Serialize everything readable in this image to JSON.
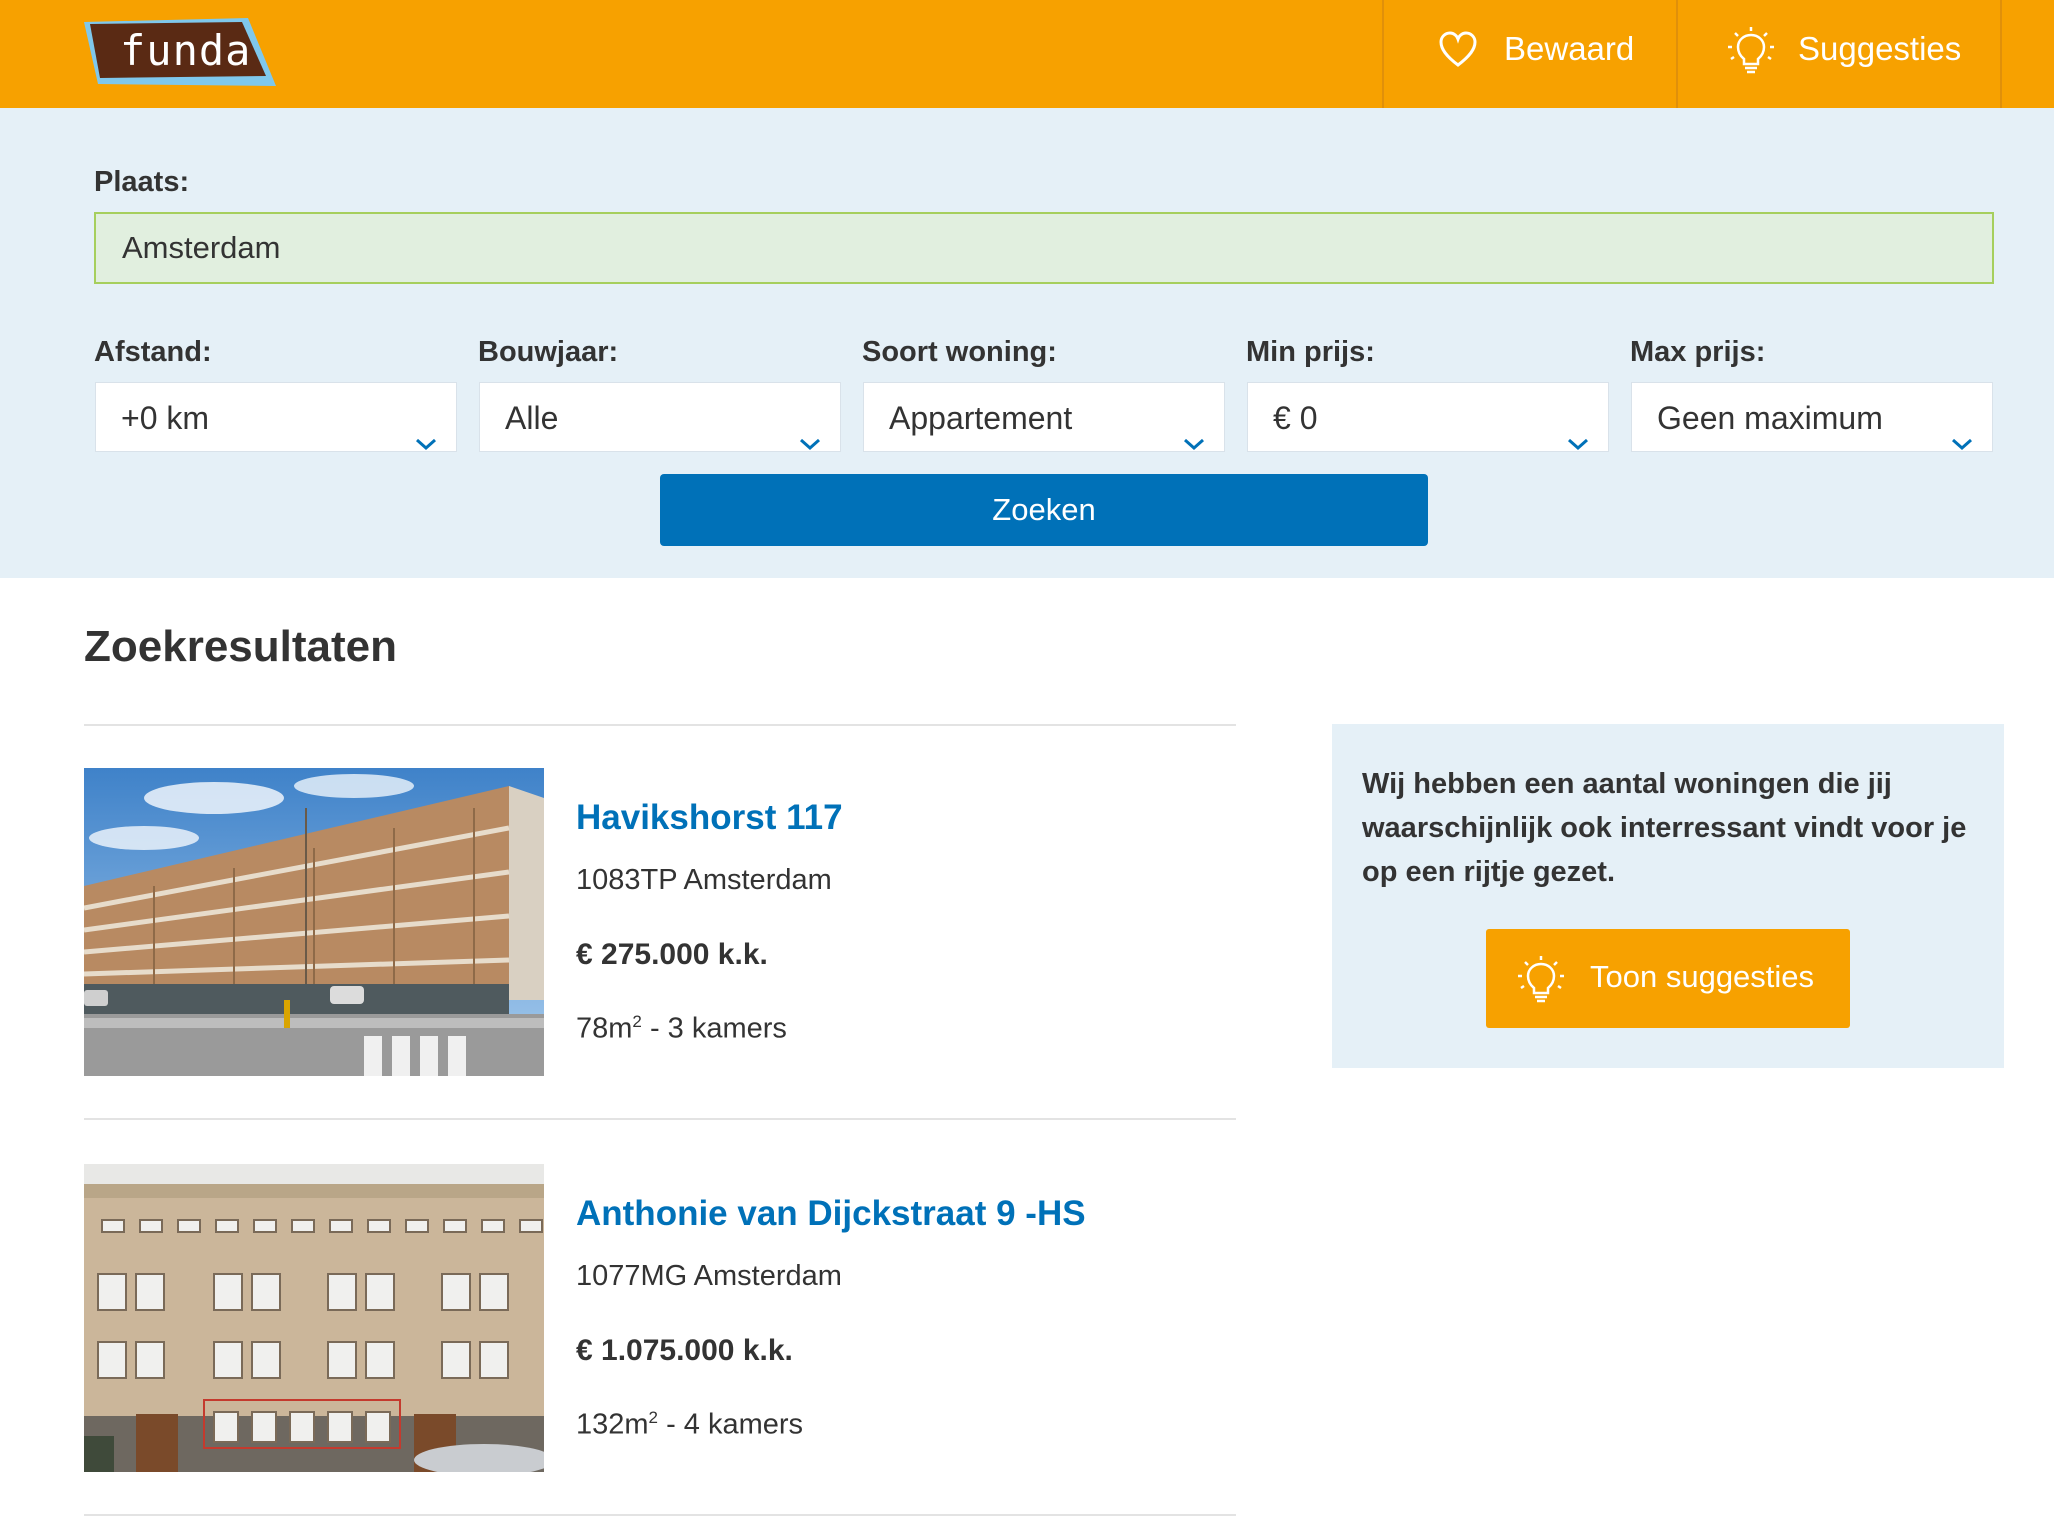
{
  "header": {
    "logo_text": "funda",
    "nav": [
      {
        "label": "Bewaard",
        "icon": "heart-icon"
      },
      {
        "label": "Suggesties",
        "icon": "lightbulb-icon"
      }
    ]
  },
  "search": {
    "place_label": "Plaats:",
    "place_value": "Amsterdam",
    "filters": [
      {
        "label": "Afstand:",
        "value": "+0 km"
      },
      {
        "label": "Bouwjaar:",
        "value": "Alle"
      },
      {
        "label": "Soort woning:",
        "value": "Appartement"
      },
      {
        "label": "Min prijs:",
        "value": "€ 0"
      },
      {
        "label": "Max prijs:",
        "value": "Geen maximum"
      }
    ],
    "submit_label": "Zoeken"
  },
  "results": {
    "heading": "Zoekresultaten",
    "items": [
      {
        "title": "Havikshorst 117",
        "address": "1083TP Amsterdam",
        "price": "€ 275.000 k.k.",
        "area": "78m",
        "area_sup": "2",
        "rooms": " - 3 kamers"
      },
      {
        "title": "Anthonie van Dijckstraat 9 -HS",
        "address": "1077MG Amsterdam",
        "price": "€ 1.075.000 k.k.",
        "area": "132m",
        "area_sup": "2",
        "rooms": " - 4 kamers"
      }
    ]
  },
  "suggestion": {
    "text": "Wij hebben een aantal woningen die jij waarschijnlijk ook interressant vindt voor je op een rijtje gezet.",
    "button_label": "Toon suggesties",
    "button_icon": "lightbulb-icon"
  },
  "colors": {
    "brand_orange": "#f7a100",
    "primary_blue": "#0071b8",
    "panel_blue": "#e5f0f7",
    "input_green": "#e1efdf",
    "logo_brown": "#5a2a14",
    "logo_light_blue": "#7fc8ec"
  }
}
